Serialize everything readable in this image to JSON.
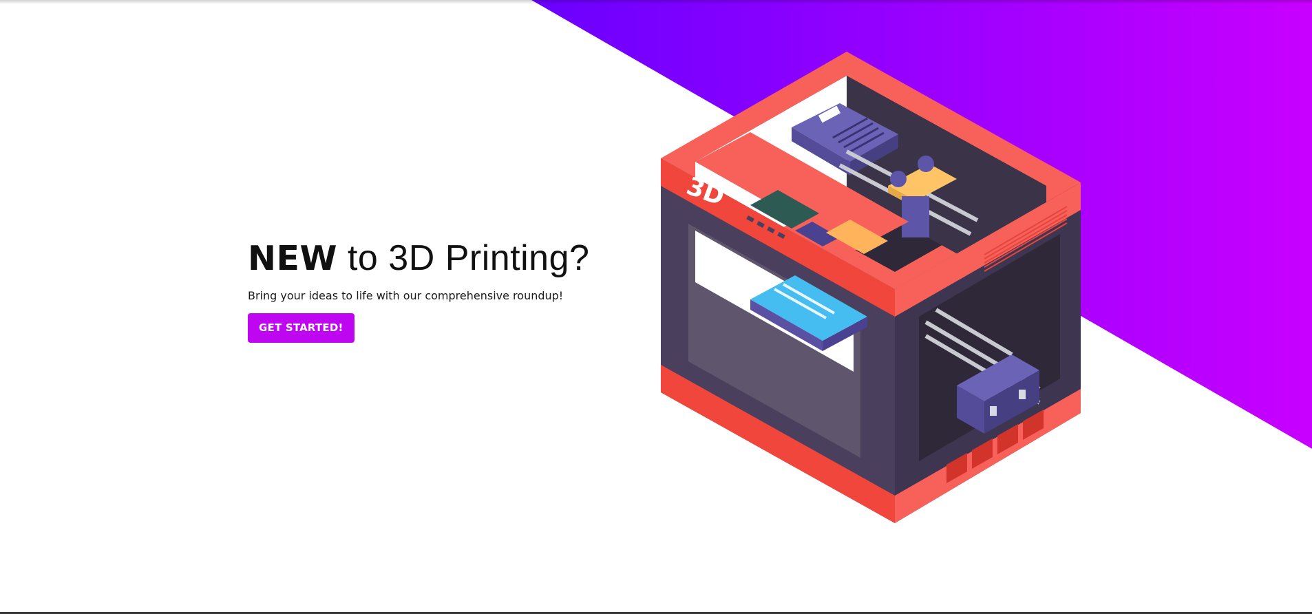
{
  "hero": {
    "title_strong": "NEW",
    "title_rest": " to 3D Printing?",
    "subtitle": "Bring your ideas to life with our comprehensive roundup!",
    "cta_label": "GET STARTED!"
  },
  "illustration": {
    "badge_text": "3D",
    "icon": "3d-printer-illustration"
  },
  "colors": {
    "accent": "#bf06f0",
    "gradient_start": "#6a00ff",
    "gradient_end": "#c800ff",
    "printer_red": "#f0463c",
    "printer_frame": "#4a3f5c"
  }
}
